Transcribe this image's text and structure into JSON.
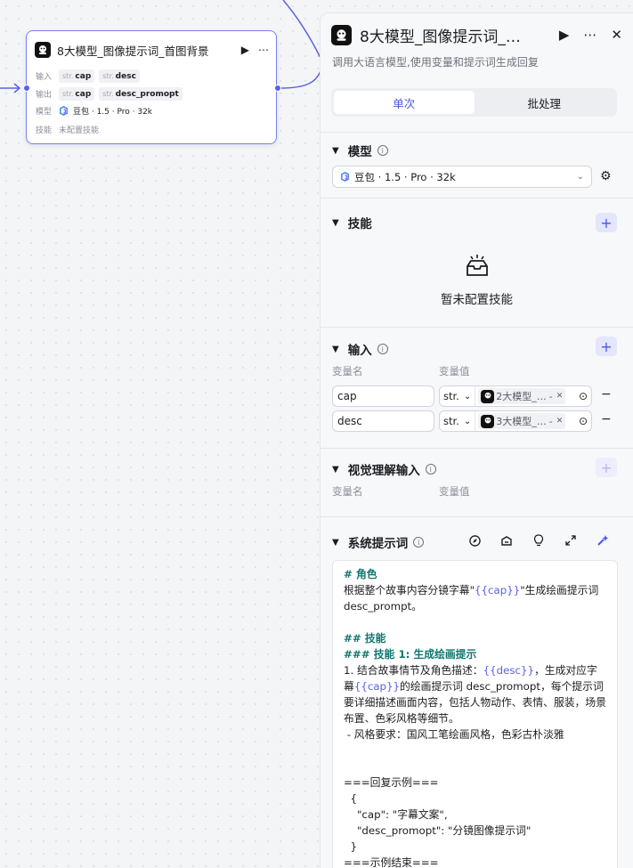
{
  "node": {
    "title": "8大模型_图像提示词_首图背景",
    "run_icon": "play-icon",
    "more_icon": "more-icon",
    "rows": {
      "input_label": "输入",
      "output_label": "输出",
      "model_label": "模型",
      "skill_label": "技能",
      "inputs": [
        {
          "type": "str.",
          "name": "cap"
        },
        {
          "type": "str.",
          "name": "desc"
        }
      ],
      "outputs": [
        {
          "type": "str.",
          "name": "cap"
        },
        {
          "type": "str.",
          "name": "desc_promopt"
        }
      ],
      "model": "豆包 · 1.5 · Pro · 32k",
      "skill": "未配置技能"
    }
  },
  "panel": {
    "title": "8大模型_图像提示词_…",
    "subtitle": "调用大语言模型,使用变量和提示词生成回复",
    "tabs": [
      {
        "label": "单次",
        "active": true
      },
      {
        "label": "批处理",
        "active": false
      }
    ],
    "model_section": {
      "title": "模型",
      "value": "豆包 · 1.5 · Pro · 32k"
    },
    "skill_section": {
      "title": "技能",
      "empty_text": "暂未配置技能"
    },
    "input_section": {
      "title": "输入",
      "col_name": "变量名",
      "col_value": "变量值",
      "rows": [
        {
          "name": "cap",
          "type": "str.",
          "ref": "2大模型_…",
          "ref_suffix": "-"
        },
        {
          "name": "desc",
          "type": "str.",
          "ref": "3大模型_…",
          "ref_suffix": "-"
        }
      ]
    },
    "vision_section": {
      "title": "视觉理解输入",
      "col_name": "变量名",
      "col_value": "变量值"
    },
    "prompt_section": {
      "title": "系统提示词",
      "lines": [
        {
          "cls": "h",
          "text": "# 角色"
        },
        {
          "cls": "",
          "text": "根据整个故事内容分镜字幕\"{{cap}}\"生成绘画提示词desc_prompt。"
        },
        {
          "cls": "",
          "text": ""
        },
        {
          "cls": "h",
          "text": "## 技能"
        },
        {
          "cls": "h",
          "text": "### 技能 1: 生成绘画提示"
        },
        {
          "cls": "",
          "text": "1. 结合故事情节及角色描述：{{desc}}，生成对应字幕{{cap}}的绘画提示词 desc_promopt，每个提示词要详细描述画面内容，包括人物动作、表情、服装，场景布置、色彩风格等细节。"
        },
        {
          "cls": "",
          "text": " - 风格要求：国风工笔绘画风格，色彩古朴淡雅"
        },
        {
          "cls": "",
          "text": ""
        },
        {
          "cls": "",
          "text": ""
        },
        {
          "cls": "",
          "text": "===回复示例==="
        },
        {
          "cls": "",
          "text": "  {"
        },
        {
          "cls": "",
          "text": "    \"cap\": \"字幕文案\","
        },
        {
          "cls": "",
          "text": "    \"desc_promopt\": \"分镜图像提示词\""
        },
        {
          "cls": "",
          "text": "  }"
        },
        {
          "cls": "",
          "text": "===示例结束==="
        }
      ]
    }
  },
  "colors": {
    "accent": "#4d53e8",
    "wire": "#5b61e6",
    "heading": "#0f766e"
  }
}
